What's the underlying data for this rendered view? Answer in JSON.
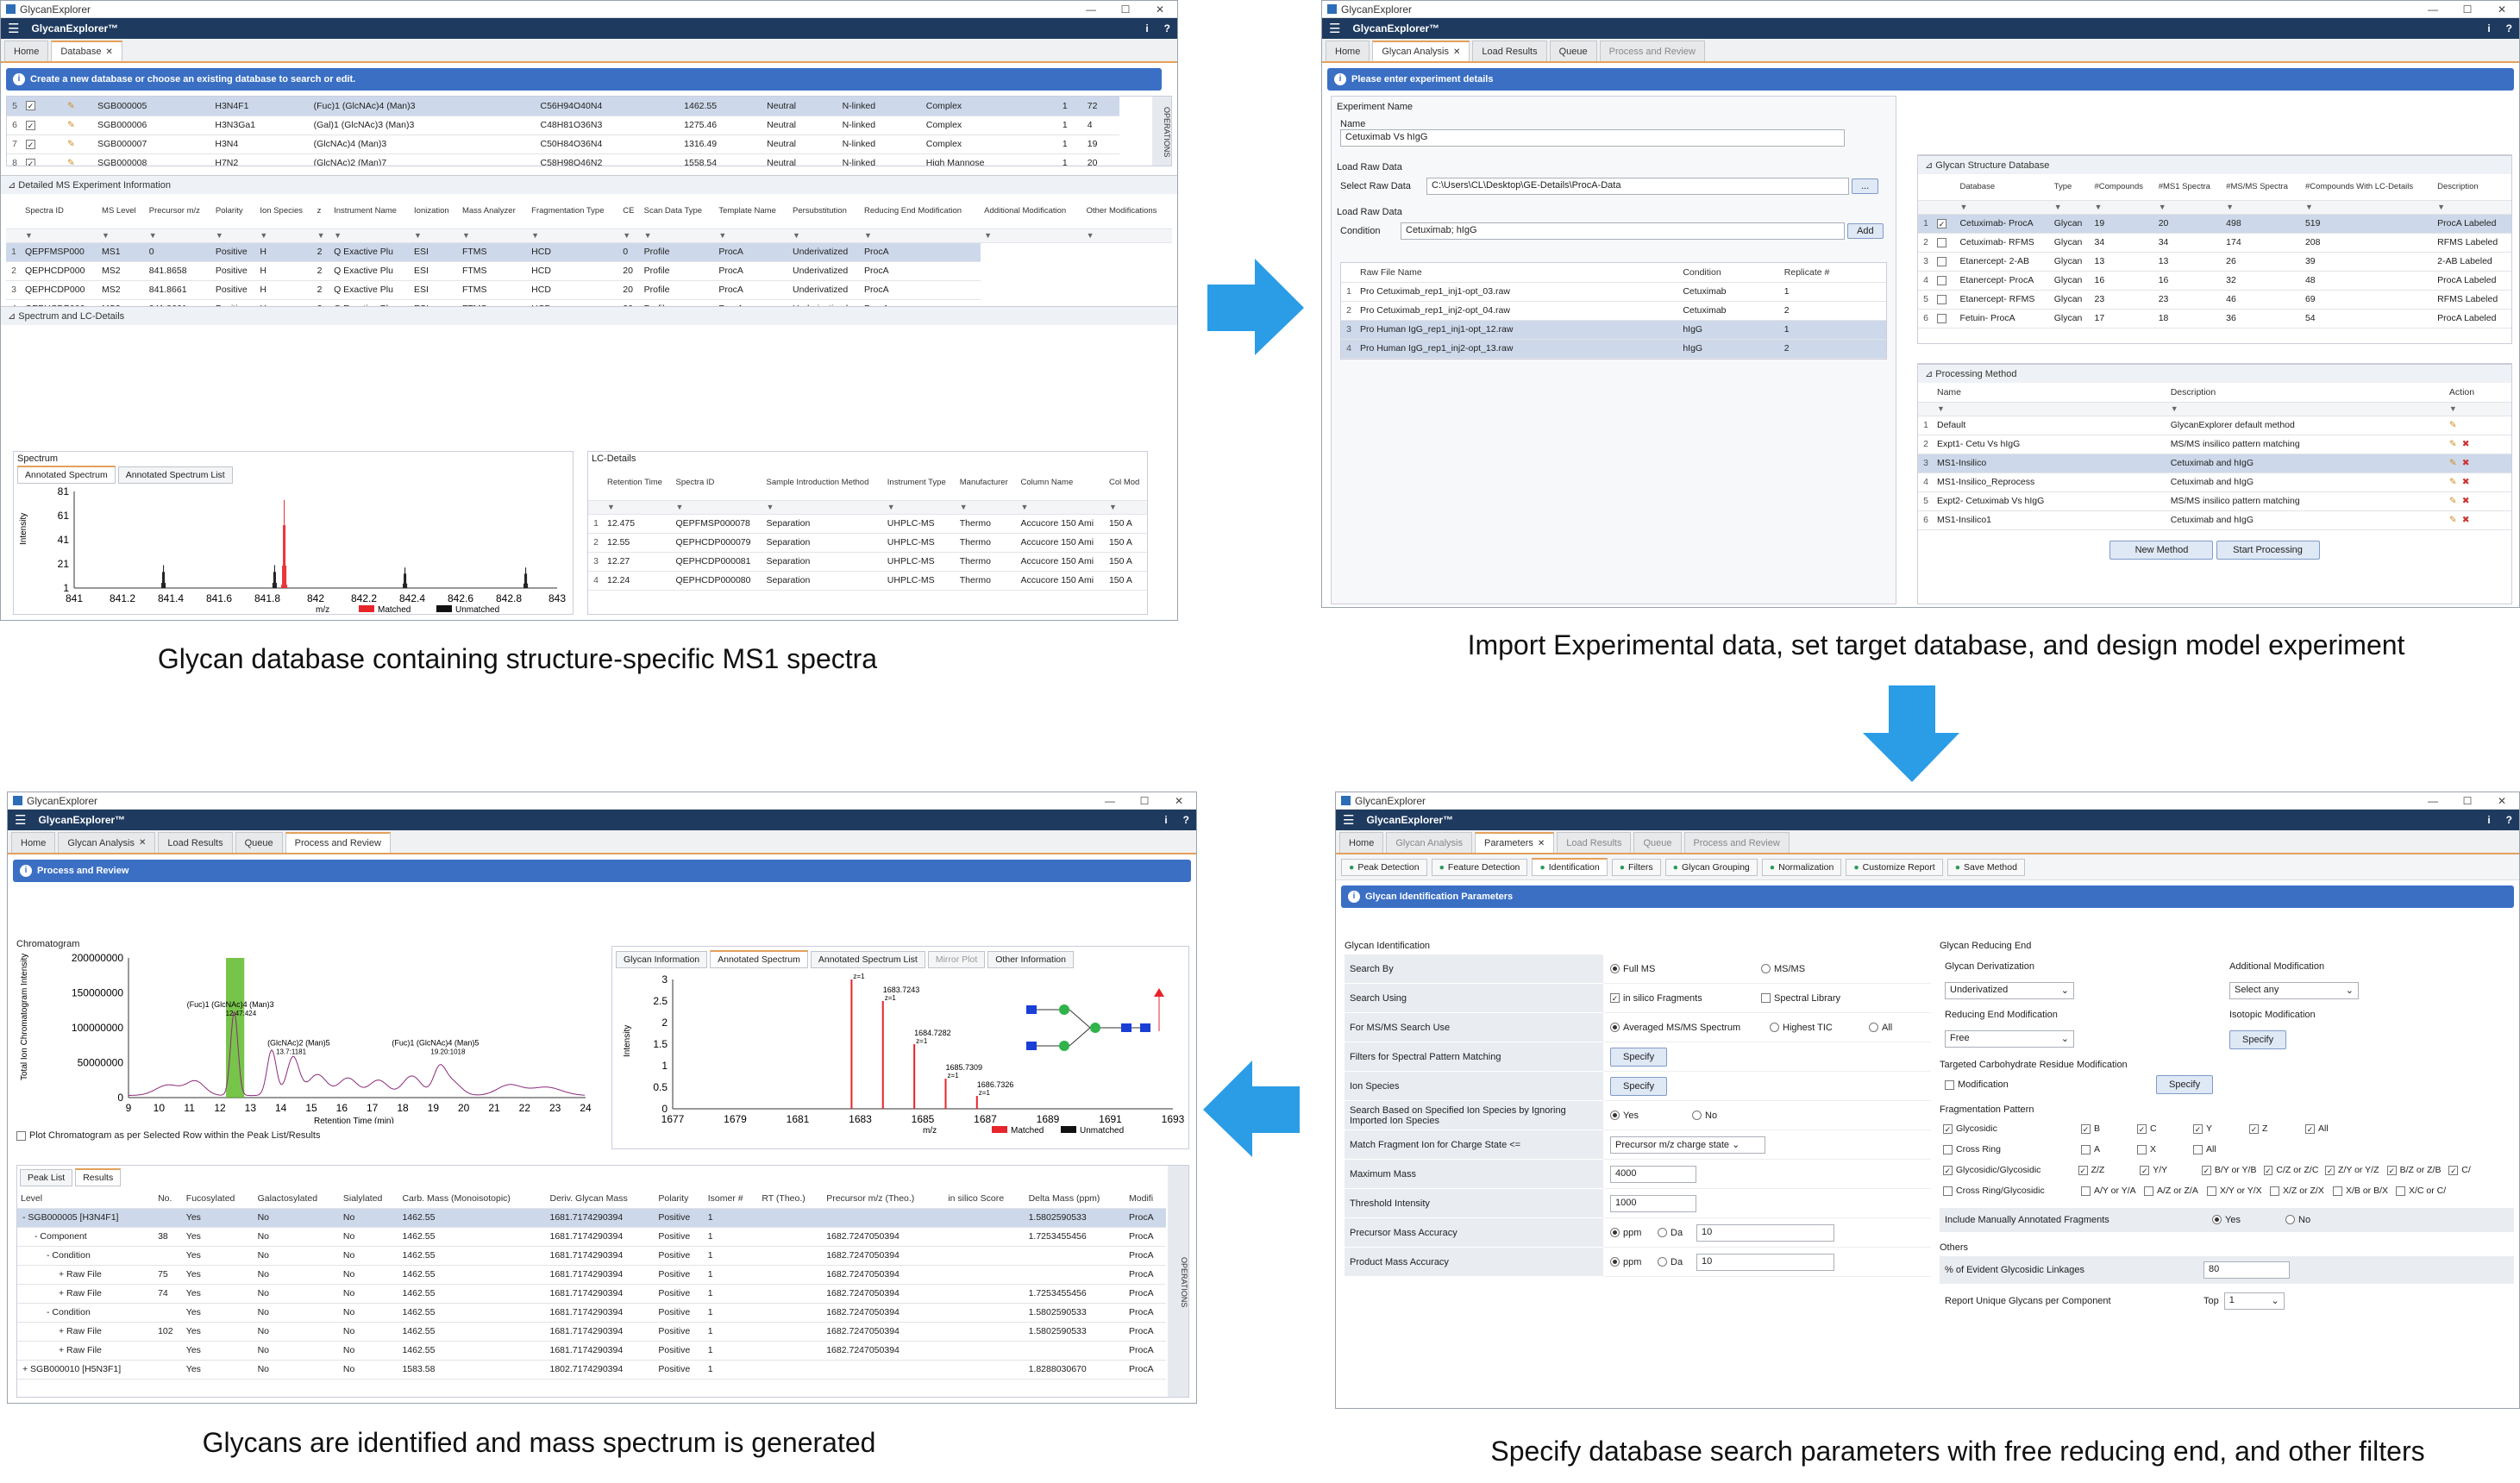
{
  "captions": {
    "p1": "Glycan database containing structure-specific MS1 spectra",
    "p2": "Import Experimental data, set target database, and design model experiment",
    "p3": "Glycans are identified and mass spectrum is generated",
    "p4": "Specify database search parameters with free reducing end, and other filters"
  },
  "app": {
    "window_title": "GlycanExplorer",
    "app_name": "GlycanExplorer™",
    "info": "i",
    "help": "?",
    "min": "—",
    "max": "☐",
    "close": "✕"
  },
  "colors": {
    "appbar": "#1e3a5f",
    "accent": "#e3a05a",
    "bluebar": "#3a6fc4",
    "arrow": "#2a9de6",
    "matched": "#e8242b",
    "unmatched": "#111111",
    "chrom": "#8a2a7a",
    "highlight": "#5fba2a"
  },
  "p1": {
    "tabs": [
      "Home",
      "Database"
    ],
    "banner": "Create a new database or choose an existing database to search or edit.",
    "operations": "OPERATIONS",
    "db_rows": [
      [
        "5",
        "SGB000005",
        "H3N4F1",
        "(Fuc)1 (GlcNAc)4 (Man)3",
        "C56H94O40N4",
        "1462.55",
        "Neutral",
        "N-linked",
        "Complex",
        "1",
        "72"
      ],
      [
        "6",
        "SGB000006",
        "H3N3Ga1",
        "(Gal)1 (GlcNAc)3 (Man)3",
        "C48H81O36N3",
        "1275.46",
        "Neutral",
        "N-linked",
        "Complex",
        "1",
        "4"
      ],
      [
        "7",
        "SGB000007",
        "H3N4",
        "(GlcNAc)4 (Man)3",
        "C50H84O36N4",
        "1316.49",
        "Neutral",
        "N-linked",
        "Complex",
        "1",
        "19"
      ],
      [
        "8",
        "SGB000008",
        "H7N2",
        "(GlcNAc)2 (Man)7",
        "C58H98O46N2",
        "1558.54",
        "Neutral",
        "N-linked",
        "High Mannose",
        "1",
        "20"
      ]
    ],
    "ms_title": "Detailed MS Experiment Information",
    "ms_headers": [
      "Spectra ID",
      "MS Level",
      "Precursor m/z",
      "Polarity",
      "Ion Species",
      "z",
      "Instrument Name",
      "Ionization",
      "Mass Analyzer",
      "Fragmentation Type",
      "CE",
      "Scan Data Type",
      "Template Name",
      "Persubstitution",
      "Reducing End Modification",
      "Additional Modification",
      "Other Modifications"
    ],
    "ms_rows": [
      [
        "1",
        "QEPFMSP000",
        "MS1",
        "0",
        "Positive",
        "H",
        "2",
        "Q Exactive Plu",
        "ESI",
        "FTMS",
        "HCD",
        "0",
        "Profile",
        "ProcA",
        "Underivatized",
        "ProcA"
      ],
      [
        "2",
        "QEPHCDP000",
        "MS2",
        "841.8658",
        "Positive",
        "H",
        "2",
        "Q Exactive Plu",
        "ESI",
        "FTMS",
        "HCD",
        "20",
        "Profile",
        "ProcA",
        "Underivatized",
        "ProcA"
      ],
      [
        "3",
        "QEPHCDP000",
        "MS2",
        "841.8661",
        "Positive",
        "H",
        "2",
        "Q Exactive Plu",
        "ESI",
        "FTMS",
        "HCD",
        "20",
        "Profile",
        "ProcA",
        "Underivatized",
        "ProcA"
      ],
      [
        "4",
        "QEPHCDP000",
        "MS2",
        "841.8661",
        "Positive",
        "H",
        "2",
        "Q Exactive Plu",
        "ESI",
        "FTMS",
        "HCD",
        "20",
        "Profile",
        "ProcA",
        "Underivatized",
        "ProcA"
      ]
    ],
    "spec_title": "Spectrum and LC-Details",
    "spectrum_label": "Spectrum",
    "subtabs": [
      "Annotated Spectrum",
      "Annotated Spectrum List"
    ],
    "ylabel": "Intensity",
    "xlabel": "m/z",
    "yticks": [
      "81",
      "61",
      "41",
      "21",
      "1"
    ],
    "xticks": [
      "841",
      "841.2",
      "841.4",
      "841.6",
      "841.8",
      "842",
      "842.2",
      "842.4",
      "842.6",
      "842.8",
      "843"
    ],
    "legend": [
      "Matched",
      "Unmatched"
    ],
    "lc_title": "LC-Details",
    "lc_headers": [
      "Retention Time",
      "Spectra ID",
      "Sample Introduction Method",
      "Instrument Type",
      "Manufacturer",
      "Column Name",
      "Col Mod"
    ],
    "lc_rows": [
      [
        "1",
        "12.475",
        "QEPFMSP000078",
        "Separation",
        "UHPLC-MS",
        "Thermo",
        "Accucore 150 Ami",
        "150 A"
      ],
      [
        "2",
        "12.55",
        "QEPHCDP000079",
        "Separation",
        "UHPLC-MS",
        "Thermo",
        "Accucore 150 Ami",
        "150 A"
      ],
      [
        "3",
        "12.27",
        "QEPHCDP000081",
        "Separation",
        "UHPLC-MS",
        "Thermo",
        "Accucore 150 Ami",
        "150 A"
      ],
      [
        "4",
        "12.24",
        "QEPHCDP000080",
        "Separation",
        "UHPLC-MS",
        "Thermo",
        "Accucore 150 Ami",
        "150 A"
      ]
    ]
  },
  "p2": {
    "tabs": [
      "Home",
      "Glycan Analysis",
      "Load Results",
      "Queue",
      "Process and Review"
    ],
    "banner": "Please enter experiment details",
    "exp_name_label": "Experiment Name",
    "name_label": "Name",
    "name_value": "Cetuximab Vs hIgG",
    "load_raw": "Load Raw Data",
    "select_raw": "Select Raw Data",
    "raw_path": "C:\\Users\\CL\\Desktop\\GE-Details\\ProcA-Data",
    "browse": "...",
    "condition_label": "Condition",
    "condition_value": "Cetuximab; hIgG",
    "add": "Add",
    "raw_headers": [
      "Raw File Name",
      "Condition",
      "Replicate #"
    ],
    "raw_rows": [
      [
        "1",
        "Pro Cetuximab_rep1_inj1-opt_03.raw",
        "Cetuximab",
        "1"
      ],
      [
        "2",
        "Pro Cetuximab_rep1_inj2-opt_04.raw",
        "Cetuximab",
        "2"
      ],
      [
        "3",
        "Pro Human IgG_rep1_inj1-opt_12.raw",
        "hIgG",
        "1"
      ],
      [
        "4",
        "Pro Human IgG_rep1_inj2-opt_13.raw",
        "hIgG",
        "2"
      ]
    ],
    "gsd_title": "Glycan Structure Database",
    "gsd_headers": [
      "Database",
      "Type",
      "#Compounds",
      "#MS1 Spectra",
      "#MS/MS Spectra",
      "#Compounds With LC-Details",
      "Description"
    ],
    "gsd_rows": [
      [
        "1",
        "Cetuximab- ProcA",
        "Glycan",
        "19",
        "20",
        "498",
        "519",
        "ProcA Labeled"
      ],
      [
        "2",
        "Cetuximab- RFMS",
        "Glycan",
        "34",
        "34",
        "174",
        "208",
        "RFMS Labeled"
      ],
      [
        "3",
        "Etanercept- 2-AB",
        "Glycan",
        "13",
        "13",
        "26",
        "39",
        "2-AB Labeled"
      ],
      [
        "4",
        "Etanercept- ProcA",
        "Glycan",
        "16",
        "16",
        "32",
        "48",
        "ProcA Labeled"
      ],
      [
        "5",
        "Etanercept- RFMS",
        "Glycan",
        "23",
        "23",
        "46",
        "69",
        "RFMS Labeled"
      ],
      [
        "6",
        "Fetuin- ProcA",
        "Glycan",
        "17",
        "18",
        "36",
        "54",
        "ProcA Labeled"
      ]
    ],
    "pm_title": "Processing Method",
    "pm_headers": [
      "Name",
      "Description",
      "Action"
    ],
    "pm_rows": [
      [
        "1",
        "Default",
        "GlycanExplorer default method"
      ],
      [
        "2",
        "Expt1- Cetu Vs hIgG",
        "MS/MS insilico pattern matching"
      ],
      [
        "3",
        "MS1-Insilico",
        "Cetuximab and hIgG"
      ],
      [
        "4",
        "MS1-Insilico_Reprocess",
        "Cetuximab and hIgG"
      ],
      [
        "5",
        "Expt2- Cetuximab Vs hIgG",
        "MS/MS insilico pattern matching"
      ],
      [
        "6",
        "MS1-Insilico1",
        "Cetuximab and hIgG"
      ]
    ],
    "new_method": "New Method",
    "start": "Start Processing"
  },
  "p3": {
    "tabs": [
      "Home",
      "Glycan Analysis",
      "Load Results",
      "Queue",
      "Process and Review"
    ],
    "banner": "Process and Review",
    "chrom_title": "Chromatogram",
    "chrom_ylabel": "Total Ion Chromatogram Intensity",
    "chrom_xlabel": "Retention Time (min)",
    "chrom_yticks": [
      "200000000",
      "150000000",
      "100000000",
      "50000000",
      "0"
    ],
    "chrom_xticks": [
      "9",
      "10",
      "11",
      "12",
      "13",
      "14",
      "15",
      "16",
      "17",
      "18",
      "19",
      "20",
      "21",
      "22",
      "23",
      "24"
    ],
    "ann1": "(Fuc)1 (GlcNAc)4 (Man)3",
    "ann1b": "12.47:424",
    "ann2": "(GlcNAc)2 (Man)5",
    "ann2b": "13.7:1181",
    "ann3": "(Fuc)1 (GlcNAc)4 (Man)5",
    "ann3b": "19.20:1018",
    "plot_chk": "Plot Chromatogram as per Selected Row within the Peak List/Results",
    "spec_tabs": [
      "Glycan Information",
      "Annotated Spectrum",
      "Annotated Spectrum List",
      "Mirror Plot",
      "Other Information"
    ],
    "spec_yticks": [
      "3",
      "2.5",
      "2",
      "1.5",
      "1",
      "0.5",
      "0"
    ],
    "spec_xticks": [
      "1677",
      "1679",
      "1681",
      "1683",
      "1685",
      "1687",
      "1689",
      "1691",
      "1693"
    ],
    "spec_ylabel": "Intensity",
    "spec_xlabel": "m/z",
    "peaks": [
      "1682.7215",
      "1683.7243",
      "1684.7282",
      "1685.7309",
      "1686.7326"
    ],
    "legend": [
      "Matched",
      "Unmatched"
    ],
    "res_tabs": [
      "Peak List",
      "Results"
    ],
    "res_headers": [
      "Level",
      "No.",
      "Fucosylated",
      "Galactosylated",
      "Sialylated",
      "Carb. Mass (Monoisotopic)",
      "Deriv. Glycan Mass",
      "Polarity",
      "Isomer #",
      "RT (Theo.)",
      "Precursor m/z (Theo.)",
      "in silico Score",
      "Delta Mass (ppm)",
      "Modifi"
    ],
    "res_rows": [
      [
        "- SGB000005 [H3N4F1]",
        "",
        "Yes",
        "No",
        "No",
        "1462.55",
        "1681.7174290394",
        "Positive",
        "1",
        "",
        "",
        "",
        "1.5802590533",
        "ProcA"
      ],
      [
        "- Component",
        "38",
        "Yes",
        "No",
        "No",
        "1462.55",
        "1681.7174290394",
        "Positive",
        "1",
        "",
        "1682.7247050394",
        "",
        "1.7253455456",
        "ProcA"
      ],
      [
        "- Condition",
        "",
        "Yes",
        "No",
        "No",
        "1462.55",
        "1681.7174290394",
        "Positive",
        "1",
        "",
        "1682.7247050394",
        "",
        "",
        "ProcA"
      ],
      [
        "+ Raw File",
        "75",
        "Yes",
        "No",
        "No",
        "1462.55",
        "1681.7174290394",
        "Positive",
        "1",
        "",
        "1682.7247050394",
        "",
        "",
        "ProcA"
      ],
      [
        "+ Raw File",
        "74",
        "Yes",
        "No",
        "No",
        "1462.55",
        "1681.7174290394",
        "Positive",
        "1",
        "",
        "1682.7247050394",
        "",
        "1.7253455456",
        "ProcA"
      ],
      [
        "- Condition",
        "",
        "Yes",
        "No",
        "No",
        "1462.55",
        "1681.7174290394",
        "Positive",
        "1",
        "",
        "1682.7247050394",
        "",
        "1.5802590533",
        "ProcA"
      ],
      [
        "+ Raw File",
        "102",
        "Yes",
        "No",
        "No",
        "1462.55",
        "1681.7174290394",
        "Positive",
        "1",
        "",
        "1682.7247050394",
        "",
        "1.5802590533",
        "ProcA"
      ],
      [
        "+ Raw File",
        "",
        "Yes",
        "No",
        "No",
        "1462.55",
        "1681.7174290394",
        "Positive",
        "1",
        "",
        "1682.7247050394",
        "",
        "",
        "ProcA"
      ],
      [
        "+ SGB000010 [H5N3F1]",
        "",
        "Yes",
        "No",
        "No",
        "1583.58",
        "1802.7174290394",
        "Positive",
        "1",
        "",
        "",
        "",
        "1.8288030670",
        "ProcA"
      ]
    ],
    "operations": "OPERATIONS"
  },
  "p4": {
    "tabs": [
      "Home",
      "Glycan Analysis",
      "Parameters",
      "Load Results",
      "Queue",
      "Process and Review"
    ],
    "toolbar": [
      "Peak Detection",
      "Feature Detection",
      "Identification",
      "Filters",
      "Glycan Grouping",
      "Normalization",
      "Customize Report",
      "Save Method"
    ],
    "banner": "Glycan Identification Parameters",
    "gi_title": "Glycan Identification",
    "params": [
      [
        "Search By",
        "Full MS",
        "MS/MS"
      ],
      [
        "Search Using",
        "in silico Fragments",
        "Spectral Library"
      ],
      [
        "For MS/MS Search Use",
        "Averaged MS/MS Spectrum",
        "Highest TIC",
        "All"
      ],
      [
        "Filters for Spectral Pattern Matching",
        "Specify"
      ],
      [
        "Ion Species",
        "Specify"
      ],
      [
        "Search Based on Specified Ion Species by Ignoring Imported Ion Species",
        "Yes",
        "No"
      ],
      [
        "Match Fragment Ion for Charge State <=",
        "Precursor m/z charge state"
      ],
      [
        "Maximum Mass",
        "4000"
      ],
      [
        "Threshold Intensity",
        "1000"
      ],
      [
        "Precursor Mass Accuracy",
        "ppm",
        "Da",
        "10"
      ],
      [
        "Product Mass Accuracy",
        "ppm",
        "Da",
        "10"
      ]
    ],
    "gre_title": "Glycan Reducing End",
    "deriv_label": "Glycan Derivatization",
    "deriv_value": "Underivatized",
    "addmod_label": "Additional Modification",
    "addmod_value": "Select any",
    "rem_label": "Reducing End Modification",
    "rem_value": "Free",
    "iso_label": "Isotopic Modification",
    "iso_btn": "Specify",
    "tcr_title": "Targeted Carbohydrate Residue Modification",
    "mod_label": "Modification",
    "mod_btn": "Specify",
    "frag_title": "Fragmentation Pattern",
    "frag_rows": [
      [
        "Glycosidic",
        "B",
        "C",
        "Y",
        "Z",
        "All"
      ],
      [
        "Cross Ring",
        "A",
        "X",
        "All"
      ],
      [
        "Glycosidic/Glycosidic",
        "Z/Z",
        "Y/Y",
        "B/Y or Y/B",
        "C/Z or Z/C",
        "Z/Y or Y/Z",
        "B/Z or Z/B",
        "C/"
      ],
      [
        "Cross Ring/Glycosidic",
        "A/Y or Y/A",
        "A/Z or Z/A",
        "X/Y or Y/X",
        "X/Z or Z/X",
        "X/B or B/X",
        "X/C or C/"
      ]
    ],
    "manual_label": "Include Manually Annotated Fragments",
    "manual_yes": "Yes",
    "manual_no": "No",
    "others_title": "Others",
    "pct_label": "% of Evident Glycosidic Linkages",
    "pct_value": "80",
    "unique_label": "Report Unique Glycans per Component",
    "top_label": "Top",
    "top_value": "1"
  }
}
